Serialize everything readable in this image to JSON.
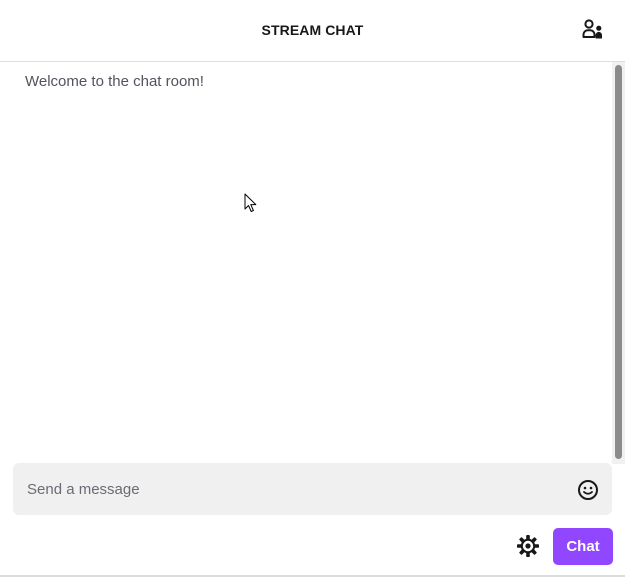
{
  "header": {
    "title": "STREAM CHAT",
    "users_icon": "users-icon"
  },
  "chat": {
    "welcome_message": "Welcome to the chat room!"
  },
  "input": {
    "placeholder": "Send a message",
    "value": "",
    "emoji_icon": "emoji-smile-icon"
  },
  "footer": {
    "settings_icon": "gear-icon",
    "chat_button_label": "Chat"
  },
  "colors": {
    "accent": "#9147ff",
    "input_bg": "#f0f0f0",
    "header_text": "#18181b",
    "muted_text": "#53535f"
  }
}
